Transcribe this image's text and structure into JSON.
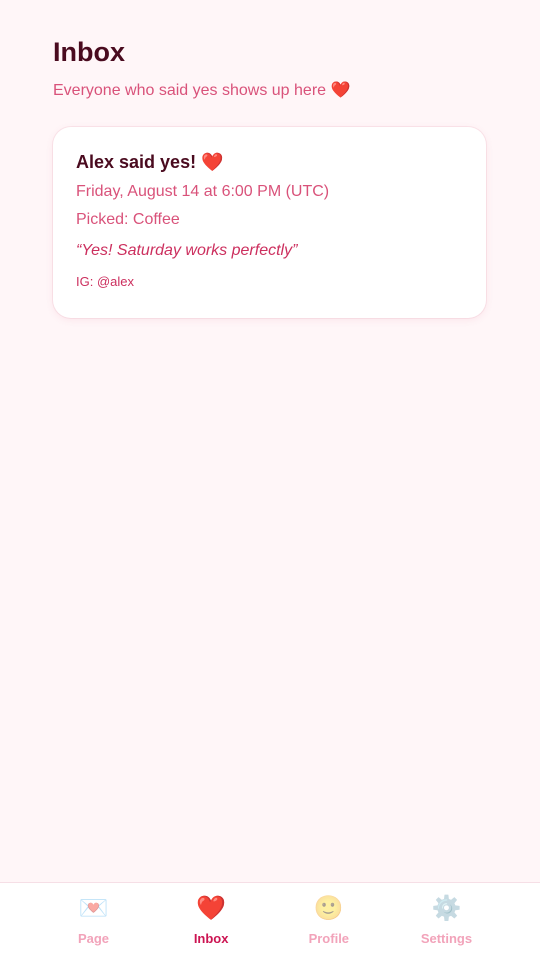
{
  "header": {
    "title": "Inbox",
    "subtitle": "Everyone who said yes shows up here",
    "subtitle_emoji": "❤️"
  },
  "inbox": {
    "items": [
      {
        "name": "Alex said yes!",
        "name_emoji": "❤️",
        "datetime": "Friday, August 14 at 6:00 PM (UTC)",
        "picked": "Picked: Coffee",
        "message": "“Yes! Saturday works perfectly”",
        "instagram": "IG: @alex"
      }
    ]
  },
  "bottom_nav": {
    "active": "Inbox",
    "items": [
      {
        "label": "Page",
        "icon": "love-letter-icon",
        "glyph": "💌"
      },
      {
        "label": "Inbox",
        "icon": "heart-icon",
        "glyph": "❤️"
      },
      {
        "label": "Profile",
        "icon": "smiley-icon",
        "glyph": "🙂"
      },
      {
        "label": "Settings",
        "icon": "gear-icon",
        "glyph": "⚙️"
      }
    ]
  },
  "colors": {
    "background": "#fff6f8",
    "title": "#4a0b1f",
    "accent": "#d9527a",
    "accent_strong": "#cc1452",
    "nav_inactive": "#f2a3ba"
  }
}
